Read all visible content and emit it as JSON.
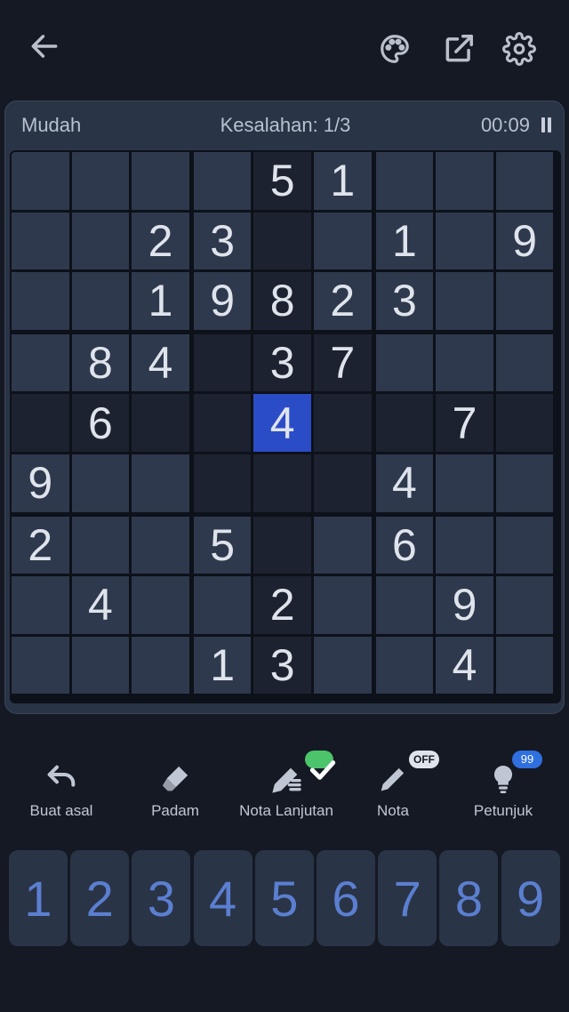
{
  "header": {
    "back_icon": "arrow-left-icon",
    "palette_icon": "palette-icon",
    "share_icon": "external-link-icon",
    "settings_icon": "gear-icon"
  },
  "status": {
    "difficulty": "Mudah",
    "mistakes": "Kesalahan: 1/3",
    "timer": "00:09",
    "pause_icon": "pause-icon"
  },
  "board": {
    "selected": [
      4,
      4
    ],
    "cells": [
      [
        "",
        "",
        "",
        "",
        "5",
        "1",
        "",
        "",
        ""
      ],
      [
        "",
        "",
        "2",
        "3",
        "",
        "",
        "1",
        "",
        "9"
      ],
      [
        "",
        "",
        "1",
        "9",
        "8",
        "2",
        "3",
        "",
        ""
      ],
      [
        "",
        "8",
        "4",
        "",
        "3",
        "7",
        "",
        "",
        ""
      ],
      [
        "",
        "6",
        "",
        "",
        "4",
        "",
        "",
        "7",
        ""
      ],
      [
        "9",
        "",
        "",
        "",
        "",
        "",
        "4",
        "",
        ""
      ],
      [
        "2",
        "",
        "",
        "5",
        "",
        "",
        "6",
        "",
        ""
      ],
      [
        "",
        "4",
        "",
        "",
        "2",
        "",
        "",
        "9",
        ""
      ],
      [
        "",
        "",
        "",
        "1",
        "3",
        "",
        "",
        "4",
        ""
      ]
    ],
    "colors": {
      "cell": "#2f394d",
      "highlight": "#1c222f",
      "selected": "#2b4cc7",
      "number": "#dfe4ec"
    }
  },
  "tools": [
    {
      "label": "Buat asal",
      "icon": "undo-icon"
    },
    {
      "label": "Padam",
      "icon": "eraser-icon"
    },
    {
      "label": "Nota Lanjutan",
      "icon": "pencil-lines-icon",
      "badge": "check"
    },
    {
      "label": "Nota",
      "icon": "pencil-icon",
      "badge": "OFF"
    },
    {
      "label": "Petunjuk",
      "icon": "lightbulb-icon",
      "badge": "99"
    }
  ],
  "numpad": [
    "1",
    "2",
    "3",
    "4",
    "5",
    "6",
    "7",
    "8",
    "9"
  ]
}
